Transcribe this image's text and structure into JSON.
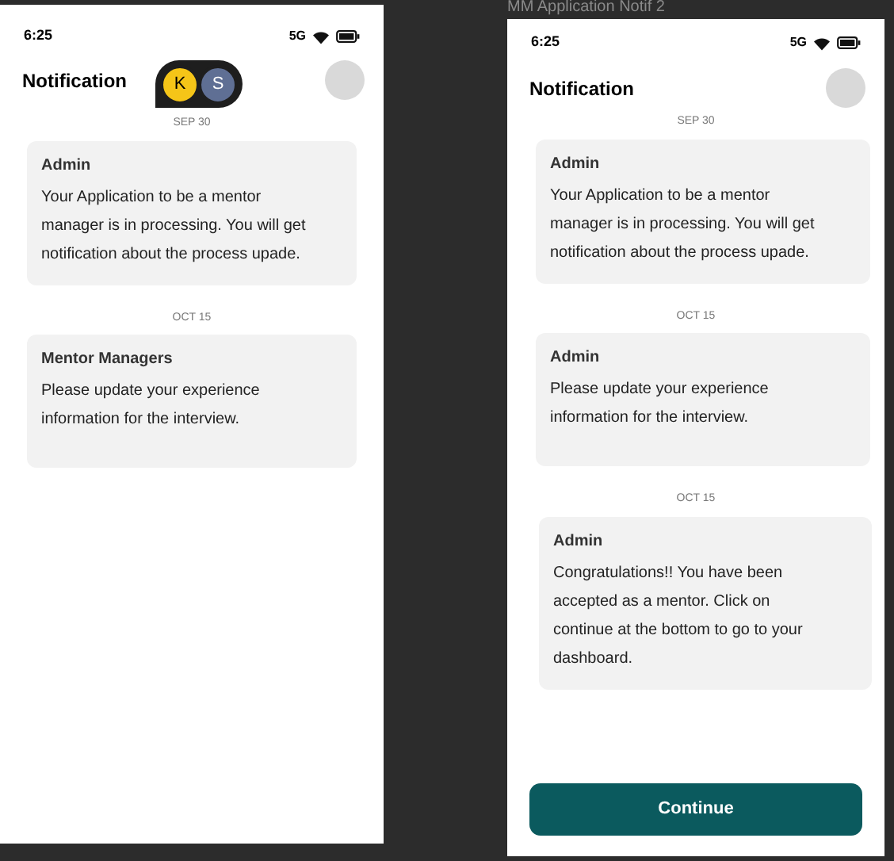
{
  "canvas_label": "MM Application Notif 2",
  "frames": [
    {
      "status_time": "6:25",
      "network": "5G",
      "title": "Notification",
      "groups": [
        {
          "date": "SEP 30",
          "sender": "Admin",
          "message": "Your Application to be a mentor manager is in processing. You will get notification about the process upade."
        },
        {
          "date": "OCT 15",
          "sender": "Mentor Managers",
          "message": "Please update your experience information for the interview."
        }
      ]
    },
    {
      "status_time": "6:25",
      "network": "5G",
      "title": "Notification",
      "groups": [
        {
          "date": "SEP 30",
          "sender": "Admin",
          "message": "Your Application to be a mentor manager is in processing. You will get notification about the process upade."
        },
        {
          "date": "OCT 15",
          "sender": "Admin",
          "message": "Please update your experience information for the interview."
        },
        {
          "date": "OCT 15",
          "sender": "Admin",
          "message": "Congratulations!! You have been accepted as a mentor. Click on continue at the bottom to go to your dashboard."
        }
      ],
      "button": "Continue"
    }
  ],
  "collaborators": [
    {
      "initial": "K",
      "color": "#f5c518"
    },
    {
      "initial": "S",
      "color": "#5f6f94"
    }
  ]
}
